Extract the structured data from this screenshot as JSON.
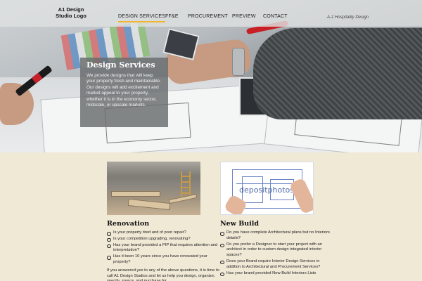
{
  "nav": {
    "logo_line1": "A1 Design",
    "logo_line2": "Studio Logo",
    "items": [
      {
        "label": "DESIGN SERVICES",
        "active": true
      },
      {
        "label": "FF&E",
        "active": false
      },
      {
        "label": "PROCUREMENT",
        "active": false
      },
      {
        "label": "PREVIEW",
        "active": false
      },
      {
        "label": "CONTACT",
        "active": false
      }
    ],
    "tagline": "A-1 Hospitality Design"
  },
  "hero": {
    "title": "Design Services",
    "text": "We provide designs that will keep your property fresh and maintainable. Our designs will add excitement and market appeal to your property, whether it is in the economy sector, midscale, or upscale markets."
  },
  "renovation": {
    "title": "Renovation",
    "bullets": [
      "Is your property tired and of poor repair?",
      "Is your competition upgrading, renovating?",
      "Has your brand provided a PIP that requires attention and interpretation?",
      "Has it been 10 years since you have renovated your property?"
    ],
    "body": "If you answered yes to any of the above questions, it is time to call A1 Design Studios and let us help you design, organize, specify, source, and purchase for"
  },
  "new_build": {
    "title": "New Build",
    "image_watermark": "depositphotos",
    "bullets": [
      "Do you have complete Architectural plans but no Interiors details?",
      "Do you prefer a Designer to start your project with an architect in order to custom design integrated interior spaces?",
      "Does your Brand require Interior Design Services in addition to Architectural and Procurement Services?",
      "Has your brand provided New Build Interiors Lists"
    ]
  },
  "colors": {
    "page_bg": "#f0e9d6",
    "nav_active_underline": "#f2b632",
    "overlay_bg": "#696c6e"
  }
}
